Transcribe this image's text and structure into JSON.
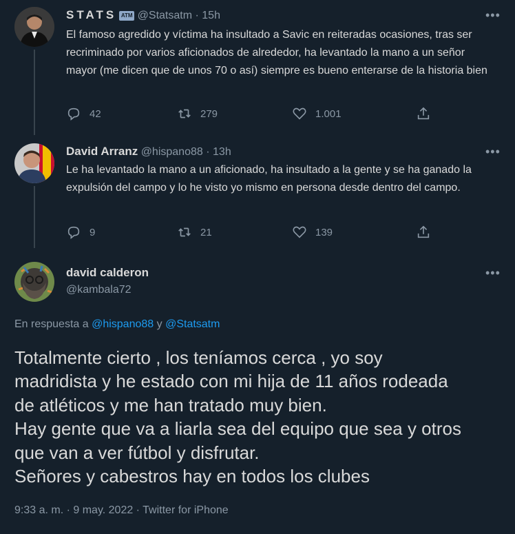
{
  "tweet1": {
    "name": "STATS",
    "badge": "ATM",
    "handle": "@Statsatm",
    "sep": "·",
    "time": "15h",
    "text": "El famoso agredido y víctima ha insultado a Savic en reiteradas ocasiones, tras ser recriminado por varios aficionados de alrededor, ha levantado la mano a un señor mayor (me dicen que de unos 70 o así) siempre es bueno enterarse de la historia bien",
    "replies": "42",
    "retweets": "279",
    "likes": "1.001",
    "more": "•••"
  },
  "tweet2": {
    "name": "David Arranz",
    "handle": "@hispano88",
    "sep": "·",
    "time": "13h",
    "text": "Le ha levantado la mano a un aficionado, ha insultado a la gente y se ha ganado la expulsión del campo y lo he visto yo mismo en persona desde dentro del campo.",
    "replies": "9",
    "retweets": "21",
    "likes": "139",
    "more": "•••"
  },
  "main": {
    "name": "david calderon",
    "handle": "@kambala72",
    "more": "•••",
    "reply_prefix": "En respuesta a",
    "reply_user1": "@hispano88",
    "reply_and": "y",
    "reply_user2": "@Statsatm",
    "text_lines": [
      "Totalmente cierto , los teníamos cerca , yo soy",
      "madridista y he estado con mi hija de 11 años rodeada",
      "de atléticos y me han tratado muy bien.",
      "Hay gente que va a liarla sea del equipo que sea y otros",
      "que van a ver fútbol y disfrutar.",
      "Señores y cabestros hay en todos los clubes"
    ],
    "timestamp": "9:33 a. m. · 9 may. 2022 · Twitter for iPhone"
  },
  "colors": {
    "background": "#15202b",
    "text": "#d9d9d9",
    "muted": "#8b98a5",
    "link": "#1d9bf0"
  },
  "icons": [
    "reply-icon",
    "retweet-icon",
    "like-icon",
    "share-icon",
    "more-icon"
  ]
}
